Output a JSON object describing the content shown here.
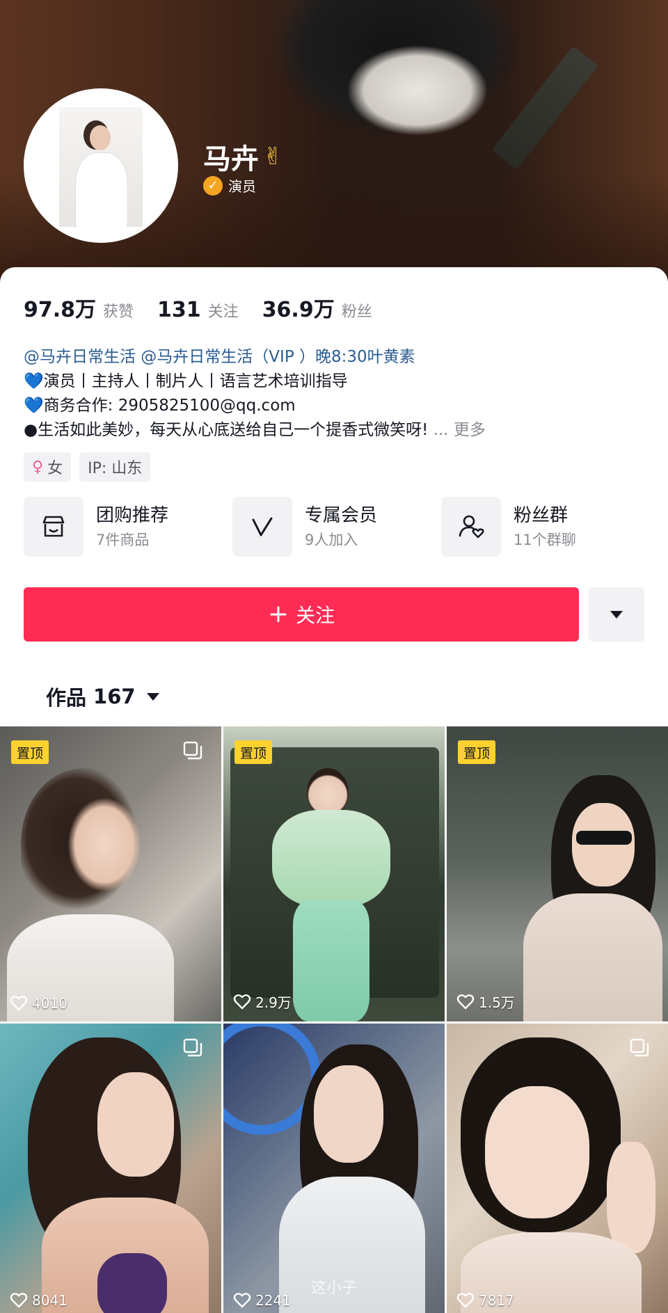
{
  "profile": {
    "name": "马卉",
    "name_emoji": "✌",
    "verified_title": "演员"
  },
  "stats": [
    {
      "value": "97.8万",
      "label": "获赞"
    },
    {
      "value": "131",
      "label": "关注"
    },
    {
      "value": "36.9万",
      "label": "粉丝"
    }
  ],
  "bio": {
    "mentions": "@马卉日常生活 @马卉日常生活（VIP ）晚8:30叶黄素",
    "line2": "演员丨主持人丨制片人丨语言艺术培训指导",
    "line3": "商务合作: 2905825100@qq.com",
    "line4": "●生活如此美妙，每天从心底送给自己一个提香式微笑呀!",
    "ellipsis": "...",
    "more": "更多",
    "line_icon": "blue-heart-icon"
  },
  "tags": {
    "gender": "女",
    "ip": "IP:  山东"
  },
  "features": [
    {
      "title": "团购推荐",
      "sub": "7件商品",
      "icon": "shop-icon"
    },
    {
      "title": "专属会员",
      "sub": "9人加入",
      "icon": "vip-icon"
    },
    {
      "title": "粉丝群",
      "sub": "11个群聊",
      "icon": "fan-group-icon"
    }
  ],
  "actions": {
    "follow_label": "关注",
    "follow_color": "#fe2c55"
  },
  "works": {
    "label": "作品",
    "count": "167"
  },
  "videos": [
    {
      "pinned": "置顶",
      "likes": "4010",
      "multi": true
    },
    {
      "pinned": "置顶",
      "likes": "2.9万",
      "multi": false
    },
    {
      "pinned": "置顶",
      "likes": "1.5万",
      "multi": false
    },
    {
      "pinned": "",
      "likes": "8041",
      "multi": true
    },
    {
      "pinned": "",
      "likes": "2241",
      "multi": false,
      "caption": "这小子"
    },
    {
      "pinned": "",
      "likes": "7817",
      "multi": true
    }
  ],
  "colors": {
    "pin": "#fdd12e",
    "verify": "#f4a623",
    "mention": "#2b5c92"
  }
}
